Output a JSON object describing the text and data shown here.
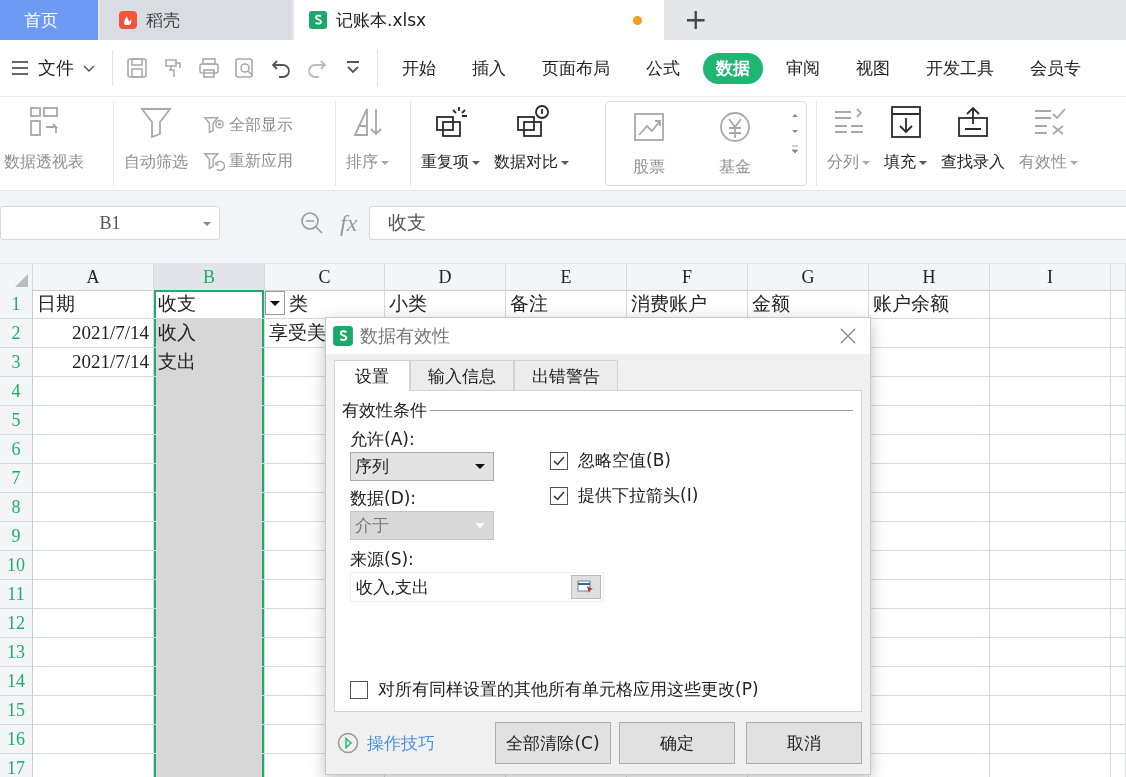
{
  "tabs": [
    {
      "label": "首页",
      "kind": "home",
      "selected": false
    },
    {
      "label": "稻壳",
      "kind": "docer",
      "selected": false
    },
    {
      "label": "记账本.xlsx",
      "kind": "file",
      "selected": true,
      "modified": true
    }
  ],
  "new_tab": "+",
  "menu": {
    "file": "文件",
    "tabs": [
      {
        "label": "开始",
        "selected": false
      },
      {
        "label": "插入",
        "selected": false
      },
      {
        "label": "页面布局",
        "selected": false
      },
      {
        "label": "公式",
        "selected": false
      },
      {
        "label": "数据",
        "selected": true
      },
      {
        "label": "审阅",
        "selected": false
      },
      {
        "label": "视图",
        "selected": false
      },
      {
        "label": "开发工具",
        "selected": false
      },
      {
        "label": "会员专",
        "selected": false
      }
    ]
  },
  "ribbon": {
    "groups": [
      {
        "kind": "plain",
        "items": [
          {
            "label": "数据透视表",
            "kind": "large",
            "disabled": true
          }
        ]
      },
      {
        "kind": "plain",
        "items": [
          {
            "label": "自动筛选",
            "kind": "large",
            "disabled": true
          },
          {
            "label": "全部显示",
            "kind": "small",
            "disabled": true
          },
          {
            "label": "重新应用",
            "kind": "small",
            "disabled": true
          }
        ]
      },
      {
        "kind": "plain",
        "items": [
          {
            "label": "排序",
            "kind": "large",
            "disabled": true,
            "dropdown": true
          }
        ]
      },
      {
        "kind": "plain",
        "items": [
          {
            "label": "重复项",
            "kind": "large",
            "disabled": false,
            "dropdown": true
          },
          {
            "label": "数据对比",
            "kind": "large",
            "disabled": false,
            "dropdown": true
          }
        ]
      },
      {
        "kind": "gallery",
        "items": [
          {
            "label": "股票",
            "kind": "large",
            "disabled": true
          },
          {
            "label": "基金",
            "kind": "large",
            "disabled": true
          }
        ]
      },
      {
        "kind": "plain",
        "items": [
          {
            "label": "分列",
            "kind": "large",
            "disabled": true,
            "dropdown": true
          },
          {
            "label": "填充",
            "kind": "large",
            "disabled": false,
            "dropdown": true
          },
          {
            "label": "查找录入",
            "kind": "large",
            "disabled": false
          },
          {
            "label": "有效性",
            "kind": "large",
            "disabled": true,
            "dropdown": true
          }
        ]
      }
    ]
  },
  "formula_bar": {
    "name_box": "B1",
    "function_label": "fx",
    "value": "收支"
  },
  "sheet": {
    "columns": [
      {
        "label": "A",
        "selected": false
      },
      {
        "label": "B",
        "selected": true
      },
      {
        "label": "C",
        "selected": false
      },
      {
        "label": "D",
        "selected": false
      },
      {
        "label": "E",
        "selected": false
      },
      {
        "label": "F",
        "selected": false
      },
      {
        "label": "G",
        "selected": false
      },
      {
        "label": "H",
        "selected": false
      },
      {
        "label": "I",
        "selected": false
      }
    ],
    "rows": [
      {
        "number": "1",
        "cells": {
          "A": {
            "text": "日期"
          },
          "B": {
            "text": "收支",
            "active": true,
            "dropdown": true
          },
          "C": {
            "text": "类"
          },
          "D": {
            "text": "小类"
          },
          "E": {
            "text": "备注"
          },
          "F": {
            "text": "消费账户"
          },
          "G": {
            "text": "金额"
          },
          "H": {
            "text": "账户余额"
          }
        }
      },
      {
        "number": "2",
        "cells": {
          "A": {
            "text": "2021/7/14",
            "kind": "date"
          },
          "B": {
            "text": "收入"
          },
          "C": {
            "text": "享受美"
          }
        }
      },
      {
        "number": "3",
        "cells": {
          "A": {
            "text": "2021/7/14",
            "kind": "date"
          },
          "B": {
            "text": "支出"
          }
        }
      },
      {
        "number": "4"
      },
      {
        "number": "5"
      },
      {
        "number": "6"
      },
      {
        "number": "7"
      },
      {
        "number": "8"
      },
      {
        "number": "9"
      },
      {
        "number": "10"
      },
      {
        "number": "11"
      },
      {
        "number": "12"
      },
      {
        "number": "13"
      },
      {
        "number": "14"
      },
      {
        "number": "15"
      },
      {
        "number": "16"
      },
      {
        "number": "17"
      }
    ]
  },
  "dialog": {
    "title": "数据有效性",
    "tabs": [
      {
        "label": "设置",
        "selected": true
      },
      {
        "label": "输入信息",
        "selected": false
      },
      {
        "label": "出错警告",
        "selected": false
      }
    ],
    "section": "有效性条件",
    "allow": {
      "label": "允许(A):",
      "value": "序列",
      "disabled": false
    },
    "data": {
      "label": "数据(D):",
      "value": "介于",
      "disabled": true
    },
    "options": [
      {
        "label": "忽略空值(B)",
        "checked": true
      },
      {
        "label": "提供下拉箭头(I)",
        "checked": true
      }
    ],
    "source": {
      "label": "来源(S):",
      "value": "收入,支出"
    },
    "apply_all": {
      "label": "对所有同样设置的其他所有单元格应用这些更改(P)",
      "checked": false
    },
    "tips_link": "操作技巧",
    "buttons": [
      "全部清除(C)",
      "确定",
      "取消"
    ]
  }
}
